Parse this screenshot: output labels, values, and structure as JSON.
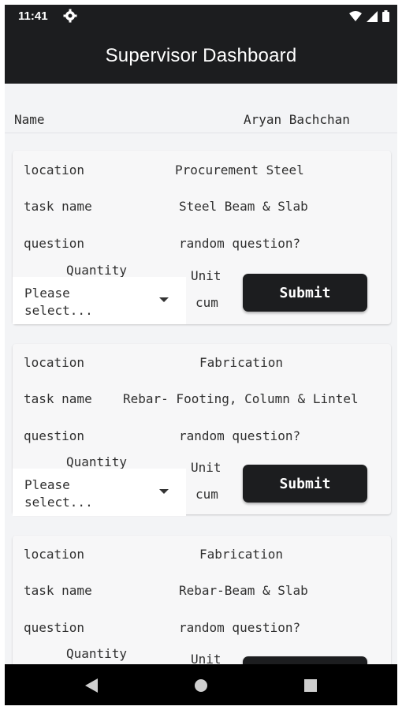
{
  "status_bar": {
    "time": "11:41"
  },
  "app_bar": {
    "title": "Supervisor Dashboard"
  },
  "name_row": {
    "label": "Name",
    "value": "Aryan Bachchan"
  },
  "field_labels": {
    "location": "location",
    "task_name": "task name",
    "question": "question",
    "quantity": "Quantity",
    "unit": "Unit"
  },
  "cards": [
    {
      "location": "Procurement Steel",
      "task_name": "Steel Beam & Slab",
      "question": "random question?",
      "unit": "cum",
      "select_placeholder": "Please\nselect...",
      "submit_label": "Submit"
    },
    {
      "location": "Fabrication",
      "task_name": "Rebar- Footing, Column & Lintel",
      "question": "random question?",
      "unit": "cum",
      "select_placeholder": "Please\nselect...",
      "submit_label": "Submit"
    },
    {
      "location": "Fabrication",
      "task_name": "Rebar-Beam & Slab",
      "question": "random question?",
      "unit": "",
      "select_placeholder": "",
      "submit_label": ""
    }
  ],
  "icons": [
    "gear-icon",
    "wifi-icon",
    "signal-icon",
    "battery-icon",
    "nav-back-icon",
    "nav-home-icon",
    "nav-recent-icon"
  ]
}
